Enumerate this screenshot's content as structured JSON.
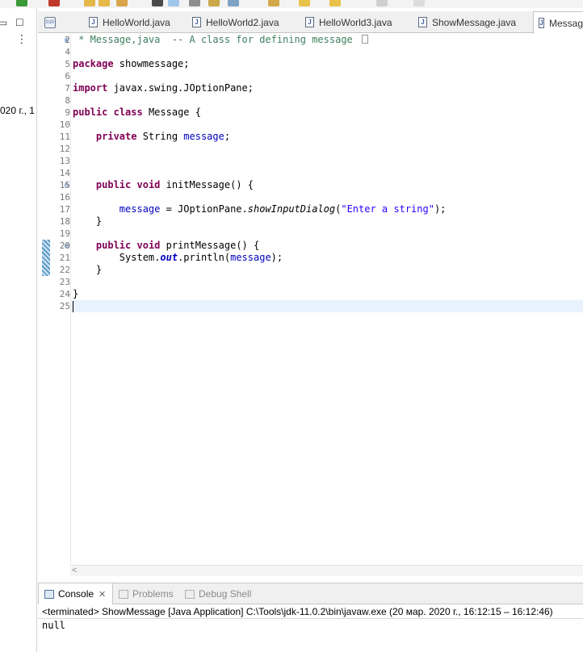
{
  "toolbar": {
    "icons": [
      "run-icon",
      "debug-icon",
      "open-folder-icon",
      "new-folder-icon",
      "wand-icon",
      "cursor-icon",
      "highlight-icon",
      "link-icon",
      "save-icon",
      "tasks-icon",
      "prev-edit-icon",
      "next-edit-icon",
      "back-icon",
      "forward-icon",
      "new-file-icon"
    ]
  },
  "left_panel": {
    "minimize_glyph": "▭",
    "maximize_glyph": "☐",
    "menu_glyph": "⋮",
    "cut_text": "020 г., 1"
  },
  "editor_tabs": [
    {
      "label": "HelloWorld.java",
      "icon": "java-file-icon"
    },
    {
      "label": "HelloWorld2.java",
      "icon": "java-file-icon"
    },
    {
      "label": "HelloWorld3.java",
      "icon": "java-file-icon"
    },
    {
      "label": "ShowMessage.java",
      "icon": "java-file-icon"
    },
    {
      "label": "Messag",
      "icon": "java-file-icon",
      "active": true
    }
  ],
  "class_file_icon_label": "010",
  "gutter": {
    "line_numbers": [
      "2",
      "4",
      "5",
      "6",
      "7",
      "8",
      "9",
      "10",
      "11",
      "12",
      "13",
      "14",
      "15",
      "16",
      "17",
      "18",
      "19",
      "20",
      "21",
      "22",
      "23",
      "24",
      "25"
    ],
    "fold_expand_glyph": "⊕",
    "fold_collapse_glyph": "⊖"
  },
  "code": {
    "l2_comment": " * Message,java  -- A class for defining message ",
    "l5_kw": "package",
    "l5_rest": " showmessage;",
    "l7_kw": "import",
    "l7_rest": " javax.swing.JOptionPane;",
    "l9_kw1": "public",
    "l9_kw2": "class",
    "l9_rest": " Message {",
    "l11_kw": "private",
    "l11_type": " String ",
    "l11_field": "message",
    "l11_end": ";",
    "l15_kw1": "public",
    "l15_kw2": "void",
    "l15_rest": " initMessage() {",
    "l17_field": "message",
    "l17_mid": " = JOptionPane.",
    "l17_method": "showInputDialog",
    "l17_open": "(",
    "l17_str": "\"Enter a string\"",
    "l17_close": ");",
    "l18": "    }",
    "l20_kw1": "public",
    "l20_kw2": "void",
    "l20_rest": " printMessage() {",
    "l21_sys": "System.",
    "l21_out": "out",
    "l21_mid": ".println(",
    "l21_field": "message",
    "l21_end": ");",
    "l22": "    }",
    "l24": "}"
  },
  "console": {
    "tabs": [
      {
        "label": "Console",
        "active": true,
        "icon": "console-icon"
      },
      {
        "label": "Problems",
        "active": false,
        "icon": "problems-icon"
      },
      {
        "label": "Debug Shell",
        "active": false,
        "icon": "debug-shell-icon"
      }
    ],
    "close_glyph": "✕",
    "description": "<terminated> ShowMessage [Java Application] C:\\Tools\\jdk-11.0.2\\bin\\javaw.exe  (20 мар. 2020 г., 16:12:15 – 16:12:46)",
    "output": "null"
  },
  "scroll_left_glyph": "<",
  "colors": {
    "keyword": "#7f0055",
    "comment": "#3f7f5f",
    "string": "#2a00ff",
    "field": "#0000c0",
    "current_line": "#e8f2fe"
  }
}
